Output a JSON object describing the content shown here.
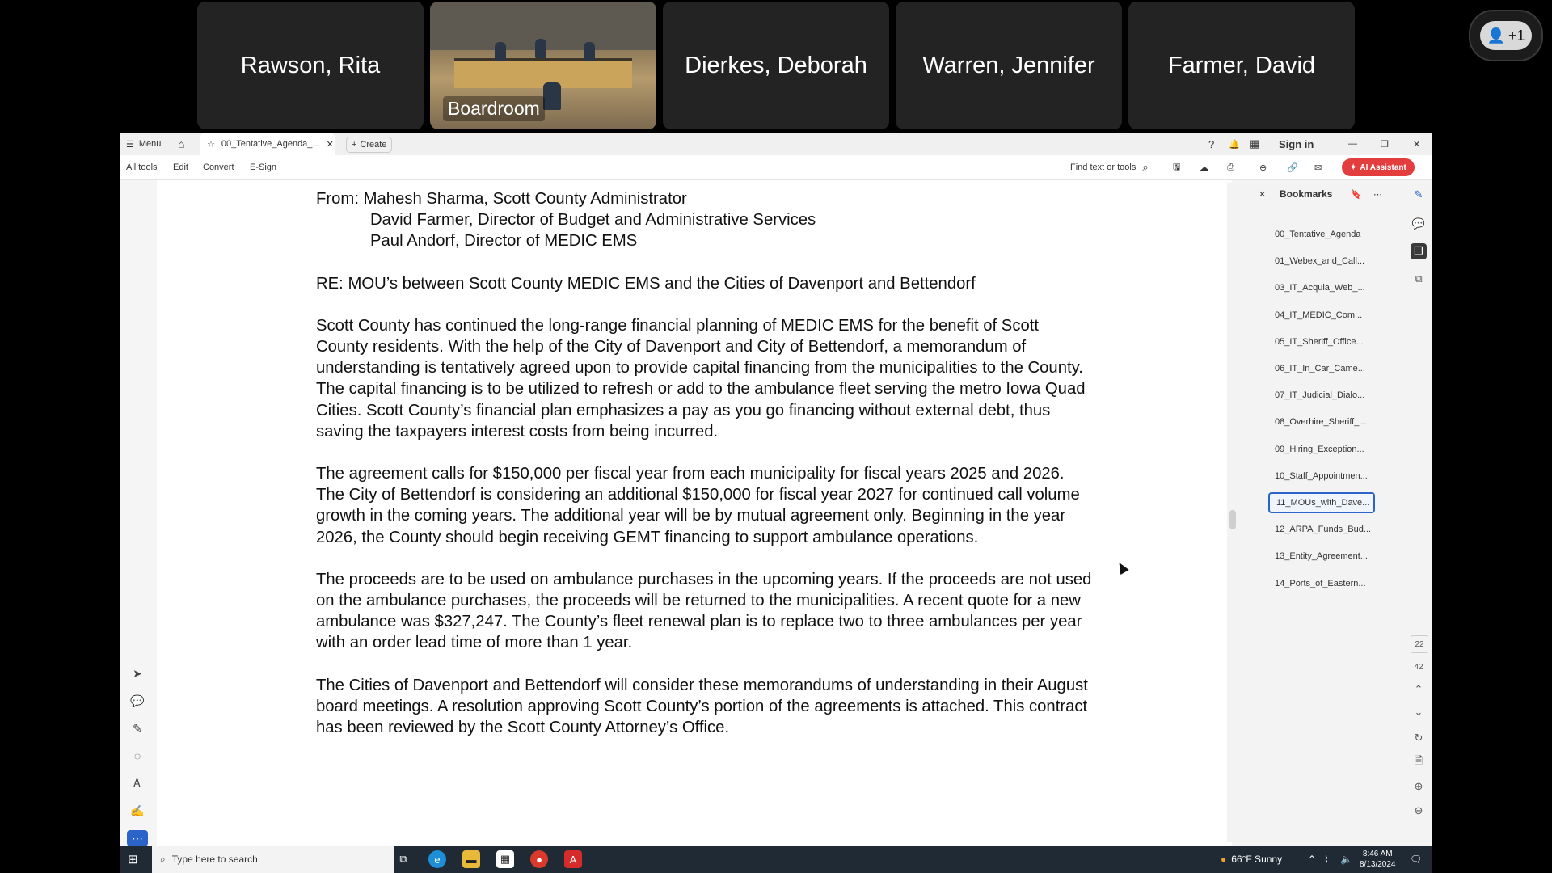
{
  "meeting": {
    "tiles": [
      {
        "name": "Rawson, Rita"
      },
      {
        "name": "Boardroom"
      },
      {
        "name": "Dierkes, Deborah"
      },
      {
        "name": "Warren, Jennifer"
      },
      {
        "name": "Farmer, David"
      }
    ],
    "participants_badge": "+1"
  },
  "acrobat": {
    "topbar": {
      "menu": "Menu",
      "tab_title": "00_Tentative_Agenda_...",
      "create": "Create",
      "sign_in": "Sign in"
    },
    "toolbar": {
      "all_tools": "All tools",
      "edit": "Edit",
      "convert": "Convert",
      "esign": "E-Sign",
      "find": "Find text or tools",
      "ai_assistant": "AI Assistant"
    },
    "document": {
      "from_lines": [
        "From: Mahesh Sharma, Scott County Administrator",
        "David Farmer, Director of Budget and Administrative Services",
        "Paul Andorf, Director of MEDIC EMS"
      ],
      "re_line": "RE: MOU’s between Scott County MEDIC EMS and the Cities of Davenport and Bettendorf",
      "paragraphs": [
        "Scott County has continued the long-range financial planning of MEDIC EMS for the benefit of Scott County residents.  With the help of the City of Davenport and City of Bettendorf, a memorandum of understanding is tentatively agreed upon to provide capital financing from the municipalities to the County.  The capital financing is to be utilized to refresh or add to the ambulance fleet serving the metro Iowa Quad Cities.  Scott County’s financial plan emphasizes a pay as you go financing without external debt, thus saving the taxpayers interest costs from being incurred.",
        "The agreement calls for $150,000 per fiscal year from each municipality for fiscal years 2025 and 2026.  The City of Bettendorf is considering an additional $150,000 for fiscal year 2027 for continued call volume growth in the coming years.  The additional year will be by mutual agreement only.  Beginning in the year 2026, the County should begin receiving GEMT financing to support ambulance operations.",
        "The proceeds are to be used on ambulance purchases in the upcoming years.  If the proceeds are not used on the ambulance purchases, the proceeds will be returned to the municipalities.  A recent quote for a new ambulance was $327,247. The County’s fleet renewal plan is to replace two to three ambulances per year with an order lead time of more than 1 year.",
        "The Cities of Davenport and Bettendorf will consider these memorandums of understanding in their August board meetings.   A resolution approving Scott County’s portion of the agreements is attached.   This contract has been reviewed by the Scott County Attorney’s Office."
      ]
    },
    "bookmarks": {
      "title": "Bookmarks",
      "items": [
        "00_Tentative_Agenda",
        "01_Webex_and_Call...",
        "03_IT_Acquia_Web_...",
        "04_IT_MEDIC_Com...",
        "05_IT_Sheriff_Office...",
        "06_IT_In_Car_Came...",
        "07_IT_Judicial_Dialo...",
        "08_Overhire_Sheriff_...",
        "09_Hiring_Exception...",
        "10_Staff_Appointmen...",
        "11_MOUs_with_Dave...",
        "12_ARPA_Funds_Bud...",
        "13_Entity_Agreement...",
        "14_Ports_of_Eastern..."
      ],
      "active_index": 10
    },
    "page_numbers": {
      "current": "22",
      "total": "42"
    }
  },
  "taskbar": {
    "search_placeholder": "Type here to search",
    "weather": "66°F  Sunny",
    "time": "8:46 AM",
    "date": "8/13/2024"
  },
  "colors": {
    "accent": "#2a64c8",
    "ai_button": "#e33d3d",
    "taskbar": "#1f2a35"
  }
}
